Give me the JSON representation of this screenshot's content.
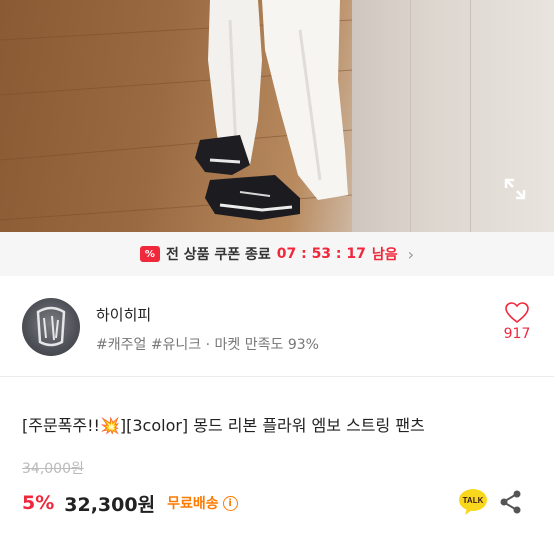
{
  "hero": {
    "expand_icon": "expand-arrows-icon"
  },
  "coupon": {
    "icon_text": "%",
    "label": "전 상품 쿠폰 종료",
    "timer": "07 : 53 : 17",
    "suffix": "남음",
    "chevron": "›"
  },
  "shop": {
    "name": "하이히피",
    "tags": "#캐주얼 #유니크 · 마켓 만족도 93%",
    "like_count": "917"
  },
  "product": {
    "title": "[주문폭주!!💥][3color] 몽드 리본 플라워 엠보 스트링 팬츠",
    "original_price": "34,000원",
    "discount": "5%",
    "price": "32,300원",
    "shipping": "무료배송",
    "info_icon_text": "i"
  },
  "actions": {
    "talk_label": "TALK"
  },
  "colors": {
    "accent": "#f0283c",
    "shipping": "#ff7a00",
    "talk": "#f9d71c"
  }
}
